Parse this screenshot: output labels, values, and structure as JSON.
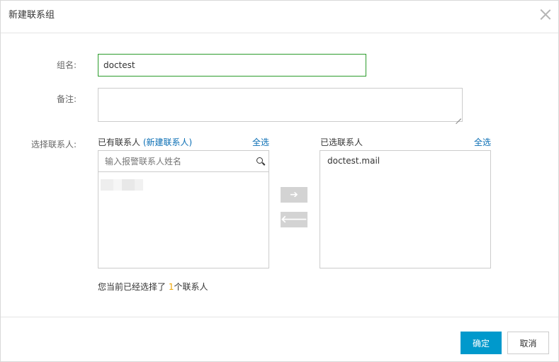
{
  "dialog": {
    "title": "新建联系组"
  },
  "form": {
    "group_name_label": "组名:",
    "group_name_value": "doctest",
    "remark_label": "备注:",
    "remark_value": "",
    "select_contacts_label": "选择联系人:"
  },
  "available": {
    "title": "已有联系人",
    "new_contact_link": "(新建联系人)",
    "select_all": "全选",
    "search_placeholder": "输入报警联系人姓名"
  },
  "selected": {
    "title": "已选联系人",
    "select_all": "全选",
    "items": [
      "doctest.mail"
    ]
  },
  "arrows": {
    "move_right": "➔",
    "move_left": "🡐"
  },
  "summary": {
    "prefix": "您当前已经选择了 ",
    "count": "1",
    "suffix": "个联系人"
  },
  "footer": {
    "confirm_label": "确定",
    "cancel_label": "取消"
  },
  "colors": {
    "primary": "#0099cc",
    "link": "#0a6eb4",
    "focus_border": "#2c9c2c",
    "count_highlight": "#f0a500"
  },
  "icons": [
    "close-icon",
    "search-icon",
    "arrow-right-icon",
    "arrow-left-icon"
  ]
}
